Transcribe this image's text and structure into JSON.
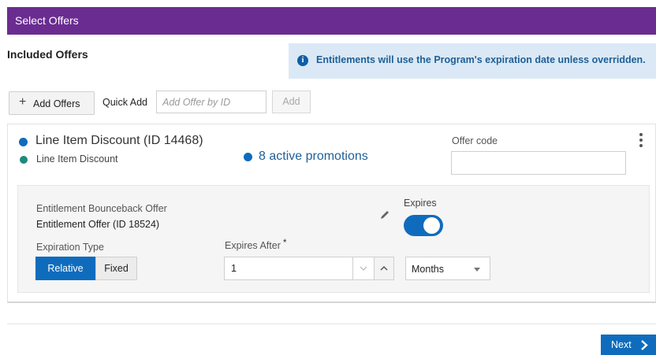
{
  "header": {
    "title": "Select Offers"
  },
  "section": {
    "title": "Included Offers"
  },
  "info_banner": {
    "icon": "info-icon",
    "text": "Entitlements will use the Program's expiration date unless overridden."
  },
  "toolbar": {
    "add_offers_label": "Add Offers",
    "quick_add_label": "Quick Add",
    "quick_add_placeholder": "Add Offer by ID",
    "quick_add_value": "",
    "add_button_label": "Add"
  },
  "offer": {
    "name": "Line Item Discount (ID 14468)",
    "subtitle": "Line Item Discount",
    "promotions_text": "8 active promotions",
    "offer_code_label": "Offer code",
    "offer_code_value": ""
  },
  "entitlement": {
    "label": "Entitlement Bounceback Offer",
    "value": "Entitlement Offer (ID 18524)",
    "expires_label": "Expires",
    "expires_enabled": true,
    "expiration_type_label": "Expiration Type",
    "expiration_type_options": [
      "Relative",
      "Fixed"
    ],
    "expiration_type_selected": "Relative",
    "expires_after_label": "Expires After",
    "required_marker": "*",
    "expires_after_value": "1",
    "unit_selected": "Months"
  },
  "footer": {
    "next_label": "Next"
  },
  "colors": {
    "header_bg": "#6a2c91",
    "primary": "#0f6cbd",
    "teal_dot": "#1b8a7e",
    "banner_bg": "#dbe9f6",
    "banner_text": "#1f5f96"
  }
}
